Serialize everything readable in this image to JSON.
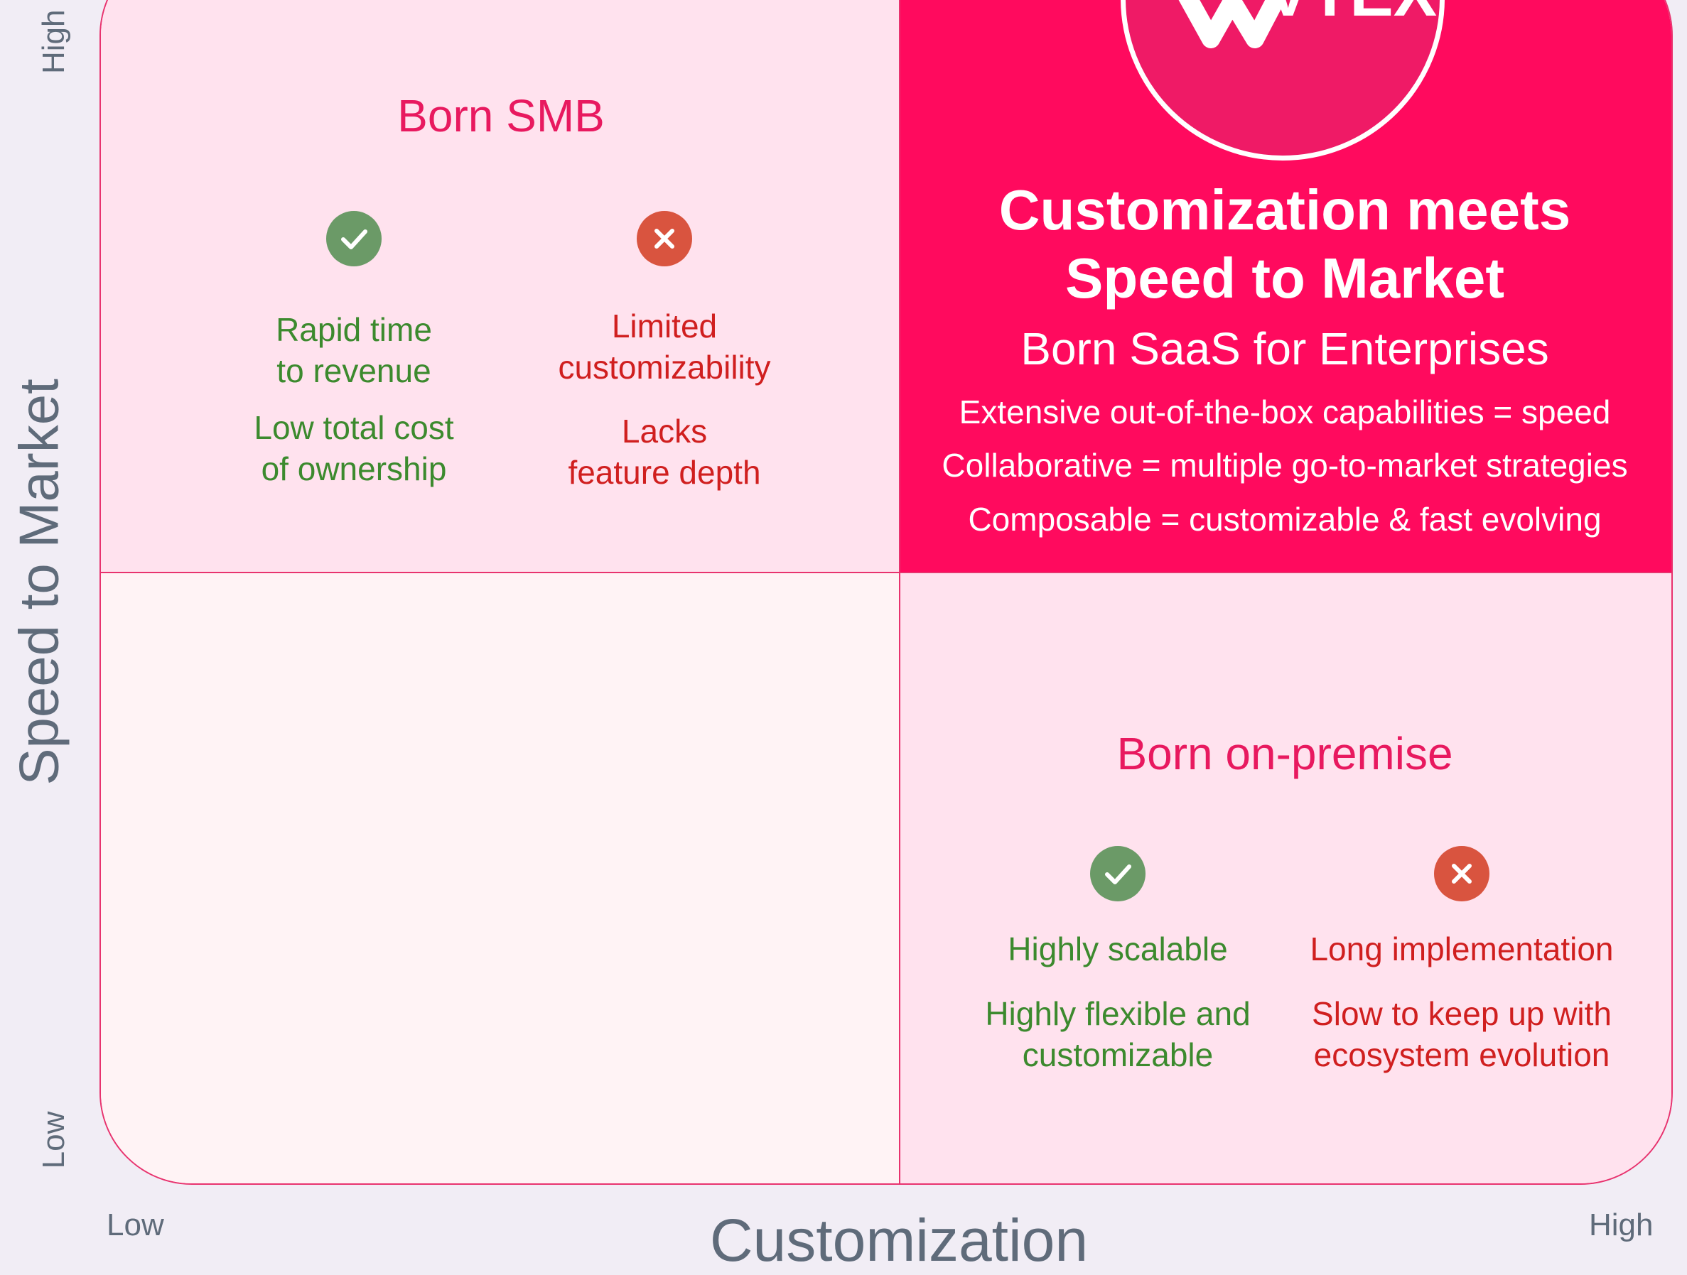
{
  "axes": {
    "y_label": "Speed to Market",
    "y_high": "High",
    "y_low": "Low",
    "x_label": "Customization",
    "x_low": "Low",
    "x_high": "High"
  },
  "top_left": {
    "title": "Born SMB",
    "pros": [
      "Rapid time to revenue",
      "Low total cost of ownership"
    ],
    "pros_lines": [
      [
        "Rapid time",
        "to revenue"
      ],
      [
        "Low total cost",
        "of ownership"
      ]
    ],
    "cons_lines": [
      [
        "Limited",
        "customizability"
      ],
      [
        "Lacks",
        "feature depth"
      ]
    ]
  },
  "top_right": {
    "logo_text": "VTEX",
    "headline_1": "Customization meets",
    "headline_2": "Speed to Market",
    "subtitle": "Born SaaS for Enterprises",
    "features": [
      "Extensive out-of-the-box capabilities = speed",
      "Collaborative = multiple go-to-market strategies",
      "Composable = customizable & fast evolving"
    ]
  },
  "bottom_right": {
    "title": "Born on-premise",
    "pros_lines": [
      [
        "Highly scalable"
      ],
      [
        "Highly flexible and",
        "customizable"
      ]
    ],
    "cons_lines": [
      [
        "Long implementation"
      ],
      [
        "Slow to keep up with",
        "ecosystem evolution"
      ]
    ]
  },
  "colors": {
    "accent": "#e8195f",
    "highlight_quadrant": "#ff0a5e",
    "pro_text": "#3c8a2e",
    "con_text": "#d01f1f",
    "check_badge": "#6b9a67",
    "cross_badge": "#d9543f"
  },
  "icons": {
    "pro": "check-circle-icon",
    "con": "x-circle-icon"
  }
}
